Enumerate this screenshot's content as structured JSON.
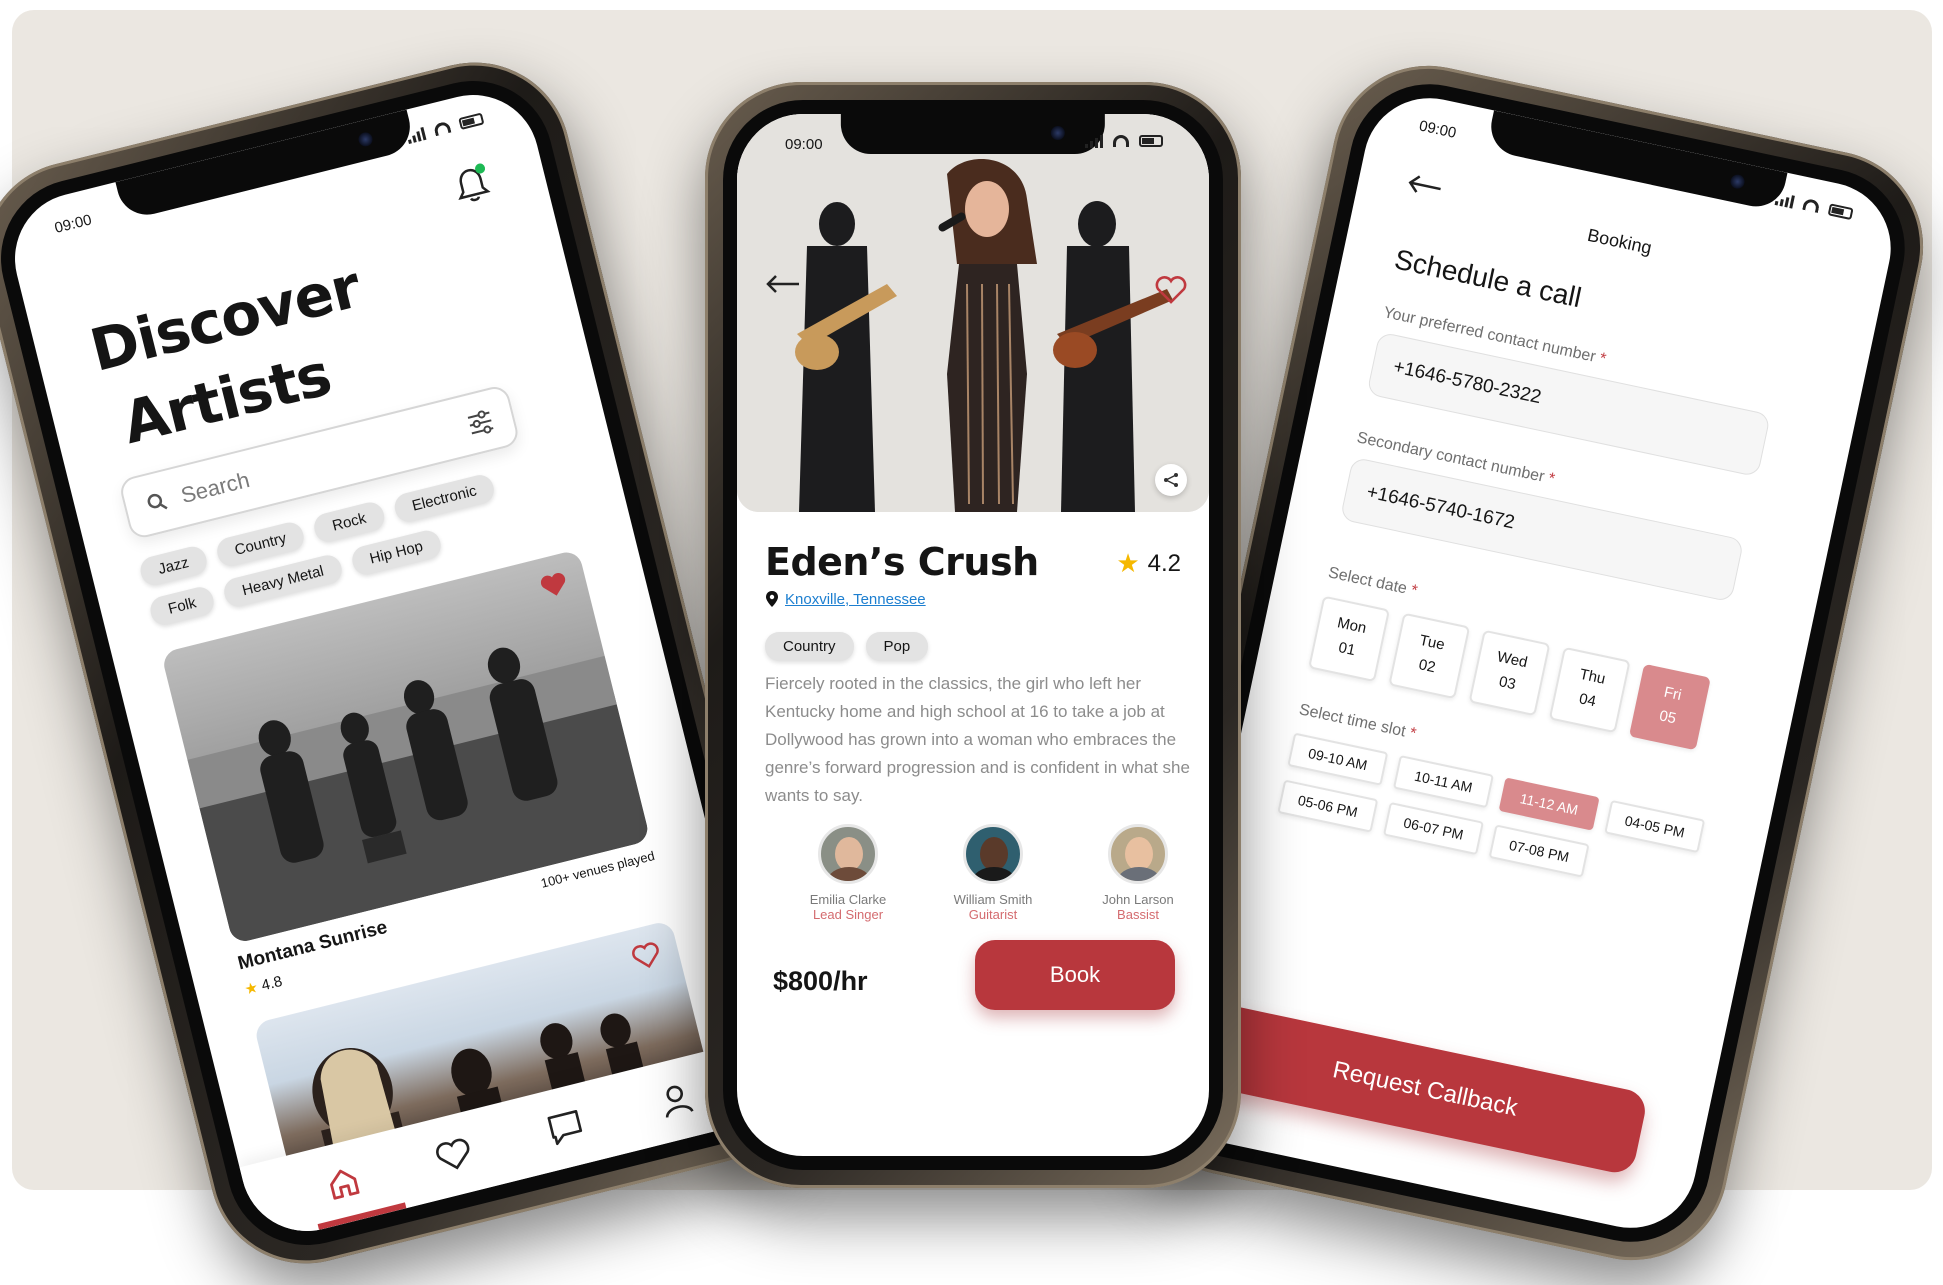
{
  "status": {
    "time": "09:00"
  },
  "discover": {
    "title_line1": "Discover",
    "title_line2": "Artists",
    "search_placeholder": "Search",
    "genres": [
      "Jazz",
      "Country",
      "Rock",
      "Electronic",
      "Folk",
      "Heavy Metal",
      "Hip Hop"
    ],
    "card": {
      "name": "Montana Sunrise",
      "venues": "100+ venues played",
      "rating": "4.8"
    },
    "nav": [
      "home-icon",
      "heart-icon",
      "chat-icon",
      "profile-icon"
    ]
  },
  "detail": {
    "name": "Eden’s Crush",
    "rating": "4.2",
    "location": "Knoxville, Tennessee",
    "genres": [
      "Country",
      "Pop"
    ],
    "description": "Fiercely rooted in the classics, the girl who left her Kentucky home and high school at 16 to take a job at Dollywood has grown into a woman who embraces the genre’s forward progression and is confident in what she wants to say.",
    "members": [
      {
        "name": "Emilia Clarke",
        "role": "Lead Singer"
      },
      {
        "name": "William Smith",
        "role": "Guitarist"
      },
      {
        "name": "John Larson",
        "role": "Bassist"
      }
    ],
    "price": "$800/hr",
    "book_label": "Book"
  },
  "booking": {
    "title": "Booking",
    "heading": "Schedule a call",
    "primary_label": "Your preferred contact number",
    "primary_value": "+1646-5780-2322",
    "secondary_label": "Secondary contact number",
    "secondary_value": "+1646-5740-1672",
    "date_label": "Select date",
    "dates": [
      {
        "day": "Mon",
        "num": "01"
      },
      {
        "day": "Tue",
        "num": "02"
      },
      {
        "day": "Wed",
        "num": "03"
      },
      {
        "day": "Thu",
        "num": "04"
      },
      {
        "day": "Fri",
        "num": "05"
      }
    ],
    "selected_date": "Fri 05",
    "slot_label": "Select time slot",
    "slots": [
      "09-10 AM",
      "10-11 AM",
      "11-12 AM",
      "04-05 PM",
      "05-06 PM",
      "06-07 PM",
      "07-08 PM"
    ],
    "selected_slot": "11-12 AM",
    "required_mark": "*",
    "cta": "Request Callback"
  },
  "colors": {
    "accent": "#b8373d",
    "selected": "#d98a8d",
    "link": "#1d7fd0",
    "star": "#f5b800",
    "notification_dot": "#1db954"
  }
}
